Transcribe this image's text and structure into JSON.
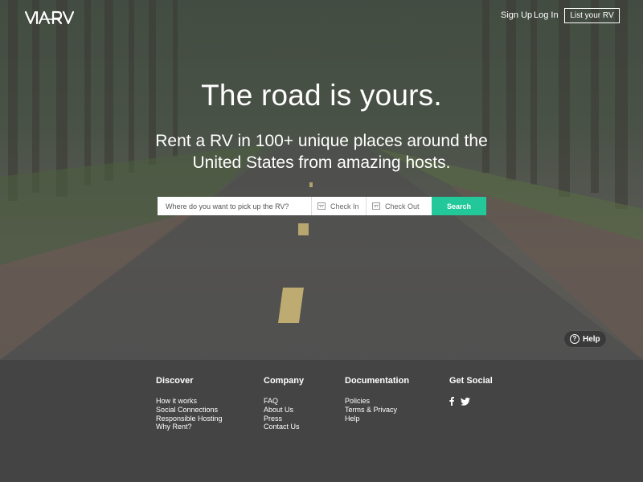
{
  "header": {
    "logo": "VIA RV",
    "signup_label": "Sign Up",
    "login_label": "Log In",
    "list_rv_label": "List your RV"
  },
  "hero": {
    "headline": "The road is yours.",
    "subhead": "Rent a RV in 100+ unique places around the United States from amazing hosts."
  },
  "search": {
    "placeholder": "Where do you want to pick up the RV?",
    "check_in_label": "Check In",
    "check_out_label": "Check Out",
    "search_label": "Search"
  },
  "help": {
    "label": "Help",
    "icon": "question-icon"
  },
  "footer": {
    "discover": {
      "title": "Discover",
      "items": [
        "How it works",
        "Social Connections",
        "Responsible Hosting",
        "Why Rent?"
      ]
    },
    "company": {
      "title": "Company",
      "items": [
        "FAQ",
        "About Us",
        "Press",
        "Contact Us"
      ]
    },
    "documentation": {
      "title": "Documentation",
      "items": [
        "Policies",
        "Terms & Privacy",
        "Help"
      ]
    },
    "social": {
      "title": "Get Social",
      "icons": [
        "facebook-icon",
        "twitter-icon"
      ]
    }
  },
  "colors": {
    "accent": "#22c89a",
    "footer_bg": "#444444"
  }
}
